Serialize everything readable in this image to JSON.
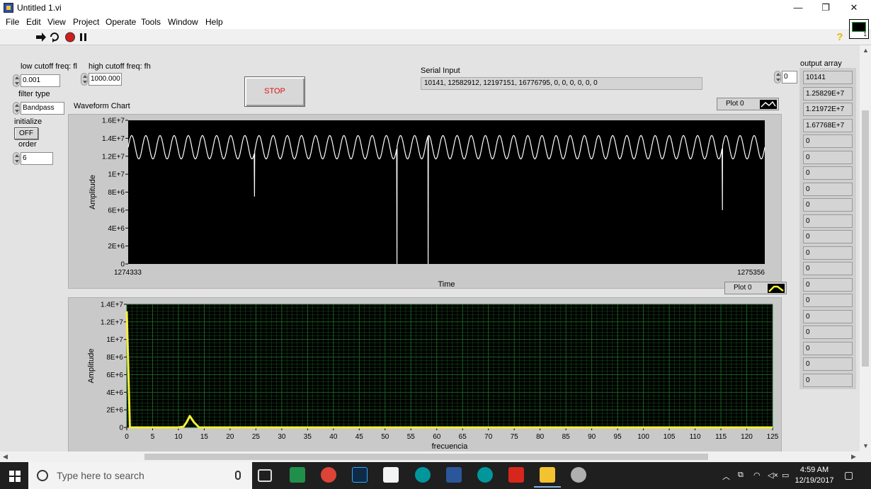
{
  "window": {
    "title": "Untitled 1.vi",
    "minimize_glyph": "—",
    "maximize_glyph": "❐",
    "close_glyph": "✕"
  },
  "menu": [
    "File",
    "Edit",
    "View",
    "Project",
    "Operate",
    "Tools",
    "Window",
    "Help"
  ],
  "toolbar": {
    "run_icon": "run-arrow-icon",
    "run_continuous_icon": "run-continuously-icon",
    "abort_icon": "abort-icon",
    "pause_icon": "pause-icon",
    "help_glyph": "?",
    "vi_icon_number": "1"
  },
  "controls": {
    "low_cutoff": {
      "label": "low cutoff freq: fl",
      "value": "0.001"
    },
    "high_cutoff": {
      "label": "high cutoff freq: fh",
      "value": "1000.000"
    },
    "filter_type": {
      "label": "filter type",
      "value": "Bandpass"
    },
    "initialize": {
      "label": "initialize",
      "value": "OFF"
    },
    "order": {
      "label": "order",
      "value": "6"
    },
    "stop": {
      "label": "STOP"
    },
    "serial_input": {
      "label": "Serial Input",
      "value": "10141, 12582912, 12197151, 16776795, 0, 0, 0, 0, 0, 0"
    }
  },
  "output_array": {
    "label": "output array",
    "index": "0",
    "values": [
      "10141",
      "1.25829E+7",
      "1.21972E+7",
      "1.67768E+7",
      "0",
      "0",
      "0",
      "0",
      "0",
      "0",
      "0",
      "0",
      "0",
      "0",
      "0",
      "0",
      "0",
      "0",
      "0",
      "0"
    ]
  },
  "colors": {
    "plot_bg": "#000000",
    "trace_white": "#ffffff",
    "trace_yellow": "#f4f13a",
    "grid_green": "#1f6a2a",
    "stop_text": "#e01010"
  },
  "chart_data": [
    {
      "type": "line",
      "title": "Waveform Chart",
      "legend": {
        "label": "Plot 0",
        "placement": "top-right"
      },
      "xlabel": "Time",
      "ylabel": "Amplitude",
      "xlim": [
        1274333,
        1275356
      ],
      "ylim": [
        0,
        16000000
      ],
      "x_tick_labels": [
        "1274333",
        "1275356"
      ],
      "y_tick_labels": [
        "0",
        "2E+6",
        "4E+6",
        "6E+6",
        "8E+6",
        "1E+7",
        "1.2E+7",
        "1.4E+7",
        "1.6E+7"
      ],
      "grid": false,
      "series": [
        {
          "name": "Plot 0",
          "baseline": 13000000,
          "amplitude": 1300000,
          "cycles": 45,
          "dropouts": [
            {
              "x": 1274536,
              "y": 7500000
            },
            {
              "x": 1274765,
              "y": 0
            },
            {
              "x": 1274815,
              "y": 0
            },
            {
              "x": 1275288,
              "y": 6000000
            }
          ]
        }
      ]
    },
    {
      "type": "line",
      "title": "",
      "legend": {
        "label": "Plot 0",
        "placement": "top-right"
      },
      "xlabel": "frecuencia",
      "ylabel": "Amplitude",
      "xlim": [
        0,
        125
      ],
      "ylim": [
        0,
        14000000
      ],
      "x_tick_labels": [
        "0",
        "5",
        "10",
        "15",
        "20",
        "25",
        "30",
        "35",
        "40",
        "45",
        "50",
        "55",
        "60",
        "65",
        "70",
        "75",
        "80",
        "85",
        "90",
        "95",
        "100",
        "105",
        "110",
        "115",
        "120",
        "125"
      ],
      "y_tick_labels": [
        "0",
        "2E+6",
        "4E+6",
        "6E+6",
        "8E+6",
        "1E+7",
        "1.2E+7",
        "1.4E+7"
      ],
      "grid": true,
      "series": [
        {
          "name": "Plot 0",
          "points": [
            [
              0,
              13200000
            ],
            [
              0.6,
              0
            ],
            [
              10,
              0
            ],
            [
              11,
              100000
            ],
            [
              11.6,
              600000
            ],
            [
              12.2,
              1300000
            ],
            [
              13,
              600000
            ],
            [
              14,
              0
            ],
            [
              125,
              0
            ]
          ]
        }
      ]
    }
  ],
  "taskbar": {
    "search_placeholder": "Type here to search",
    "time": "4:59 AM",
    "date": "12/19/2017",
    "apps": [
      "task-view",
      "pycharm",
      "chrome",
      "photoshop",
      "mail",
      "arduino",
      "word",
      "arduino-2",
      "acrobat",
      "labview",
      "labview-2"
    ]
  }
}
